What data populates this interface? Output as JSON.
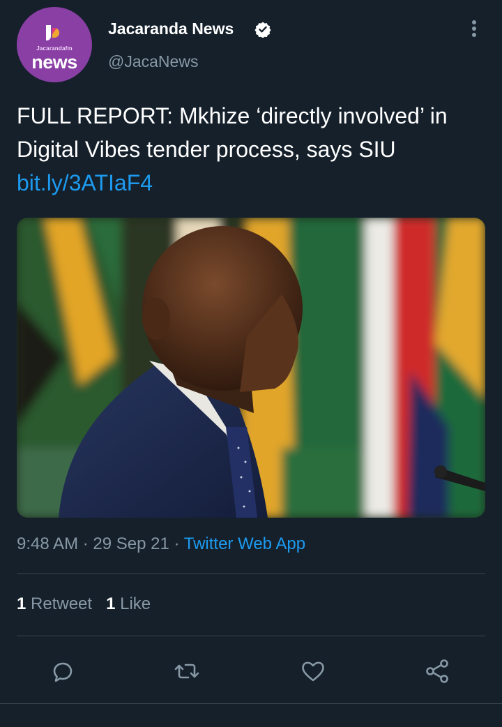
{
  "author": {
    "avatar_brand_small": "Jacarandafm",
    "avatar_brand_big": "news",
    "display_name": "Jacaranda News",
    "handle": "@JacaNews",
    "verified": true
  },
  "tweet": {
    "text": "FULL REPORT: Mkhize ‘directly involved’ in Digital Vibes tender process, says SIU",
    "link": "bit.ly/3ATIaF4",
    "media_icon": "photo-of-man-in-suit-before-south-african-flags"
  },
  "meta": {
    "time": "9:48 AM",
    "separator": "·",
    "date": "29 Sep 21",
    "source": "Twitter Web App"
  },
  "stats": {
    "retweets_count": "1",
    "retweets_label": "Retweet",
    "likes_count": "1",
    "likes_label": "Like"
  },
  "actions": {
    "icons": [
      "reply-icon",
      "retweet-icon",
      "like-icon",
      "share-icon"
    ]
  },
  "colors": {
    "background": "#15202b",
    "accent": "#1d9bf0",
    "secondary_text": "#8899a6",
    "avatar": "#8a3fa5"
  }
}
